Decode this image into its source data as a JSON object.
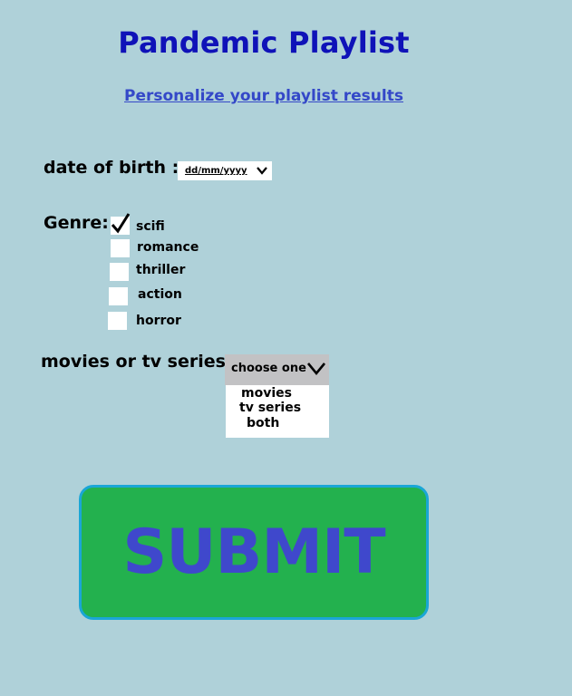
{
  "header": {
    "title": "Pandemic Playlist",
    "subtitle": "Personalize your playlist results"
  },
  "dob": {
    "label": "date of birth :",
    "value": "dd/mm/yyyy",
    "icon": "chevron-down-icon"
  },
  "genre": {
    "label": "Genre:",
    "options": [
      {
        "label": "scifi",
        "checked": true
      },
      {
        "label": "romance",
        "checked": false
      },
      {
        "label": "thriller",
        "checked": false
      },
      {
        "label": "action",
        "checked": false
      },
      {
        "label": "horror",
        "checked": false
      }
    ]
  },
  "media": {
    "label": "movies or tv series:",
    "selected": "choose one",
    "icon": "chevron-down-icon",
    "options": [
      "movies",
      "tv series",
      "both"
    ]
  },
  "submit": {
    "label": "SUBMIT"
  },
  "colors": {
    "background": "#afd1d9",
    "title": "#0f12b8",
    "subtitle": "#3448c8",
    "button_fill": "#23b14e",
    "button_border": "#1aa6d6",
    "button_text": "#3f48cc"
  }
}
